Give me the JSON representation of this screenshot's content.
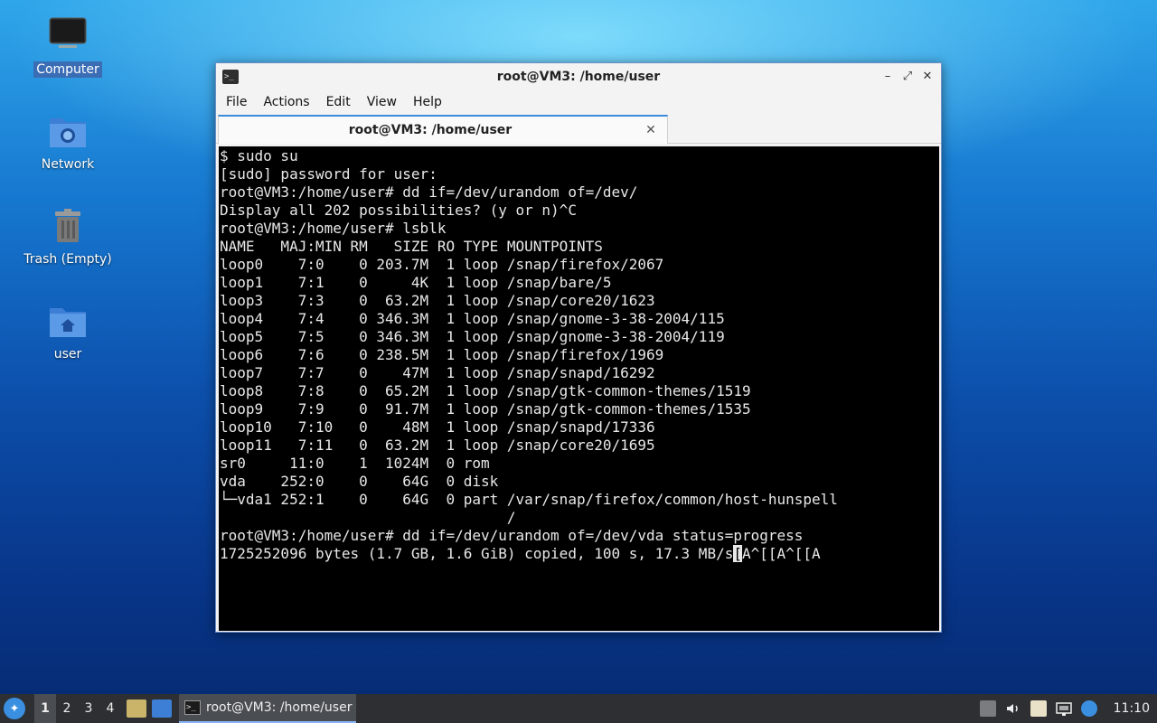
{
  "desktop": {
    "icons": [
      {
        "label": "Computer",
        "icon": "computer-icon",
        "selected": true
      },
      {
        "label": "Network",
        "icon": "network-folder-icon"
      },
      {
        "label": "Trash (Empty)",
        "icon": "trash-icon"
      },
      {
        "label": "user",
        "icon": "home-folder-icon"
      }
    ]
  },
  "window": {
    "title": "root@VM3: /home/user",
    "controls": {
      "minimize": "–",
      "maximize": "⤢",
      "close": "✕"
    },
    "menu": [
      "File",
      "Actions",
      "Edit",
      "View",
      "Help"
    ],
    "tab": {
      "label": "root@VM3: /home/user",
      "close": "✕"
    }
  },
  "terminal": {
    "lines": [
      "$ sudo su",
      "[sudo] password for user:",
      "root@VM3:/home/user# dd if=/dev/urandom of=/dev/",
      "Display all 202 possibilities? (y or n)^C",
      "root@VM3:/home/user# lsblk",
      "NAME   MAJ:MIN RM   SIZE RO TYPE MOUNTPOINTS",
      "loop0    7:0    0 203.7M  1 loop /snap/firefox/2067",
      "loop1    7:1    0     4K  1 loop /snap/bare/5",
      "loop3    7:3    0  63.2M  1 loop /snap/core20/1623",
      "loop4    7:4    0 346.3M  1 loop /snap/gnome-3-38-2004/115",
      "loop5    7:5    0 346.3M  1 loop /snap/gnome-3-38-2004/119",
      "loop6    7:6    0 238.5M  1 loop /snap/firefox/1969",
      "loop7    7:7    0    47M  1 loop /snap/snapd/16292",
      "loop8    7:8    0  65.2M  1 loop /snap/gtk-common-themes/1519",
      "loop9    7:9    0  91.7M  1 loop /snap/gtk-common-themes/1535",
      "loop10   7:10   0    48M  1 loop /snap/snapd/17336",
      "loop11   7:11   0  63.2M  1 loop /snap/core20/1695",
      "sr0     11:0    1  1024M  0 rom",
      "vda    252:0    0    64G  0 disk",
      "└─vda1 252:1    0    64G  0 part /var/snap/firefox/common/host-hunspell",
      "                                 /",
      "root@VM3:/home/user# dd if=/dev/urandom of=/dev/vda status=progress"
    ],
    "progress_before_cursor": "1725252096 bytes (1.7 GB, 1.6 GiB) copied, 100 s, 17.3 MB/s",
    "cursor_char": "[",
    "progress_after_cursor": "A^[[A^[[A"
  },
  "taskbar": {
    "start_icon": "start-menu-icon",
    "workspaces": [
      "1",
      "2",
      "3",
      "4"
    ],
    "active_workspace": "1",
    "task_label": "root@VM3: /home/user",
    "clock": "11:10",
    "colors": {
      "background": "#2d2f33",
      "accent": "#3b8bd8"
    }
  }
}
